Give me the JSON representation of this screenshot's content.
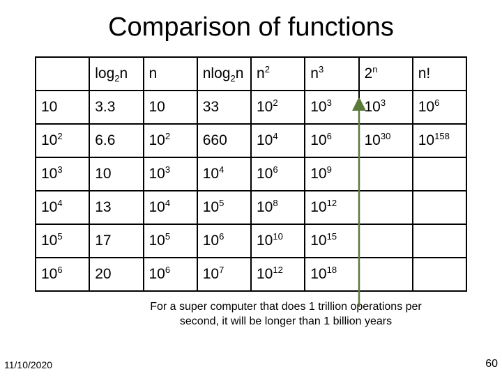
{
  "title": "Comparison of functions",
  "chart_data": {
    "type": "table",
    "columns": [
      {
        "text": "",
        "html": ""
      },
      {
        "text": "log2n",
        "html": "log<sub>2</sub>n"
      },
      {
        "text": "n",
        "html": "n"
      },
      {
        "text": "nlog2n",
        "html": "nlog<sub>2</sub>n"
      },
      {
        "text": "n^2",
        "html": "n<sup>2</sup>"
      },
      {
        "text": "n^3",
        "html": "n<sup>3</sup>"
      },
      {
        "text": "2^n",
        "html": "2<sup>n</sup>"
      },
      {
        "text": "n!",
        "html": "n!"
      }
    ],
    "rows": [
      [
        {
          "text": "10",
          "html": "10"
        },
        {
          "text": "3.3",
          "html": "3.3"
        },
        {
          "text": "10",
          "html": "10"
        },
        {
          "text": "33",
          "html": "33"
        },
        {
          "text": "10^2",
          "html": "10<sup>2</sup>"
        },
        {
          "text": "10^3",
          "html": "10<sup>3</sup>"
        },
        {
          "text": "10^3",
          "html": "10<sup>3</sup>"
        },
        {
          "text": "10^6",
          "html": "10<sup>6</sup>"
        }
      ],
      [
        {
          "text": "10^2",
          "html": "10<sup>2</sup>"
        },
        {
          "text": "6.6",
          "html": "6.6"
        },
        {
          "text": "10^2",
          "html": "10<sup>2</sup>"
        },
        {
          "text": "660",
          "html": "660"
        },
        {
          "text": "10^4",
          "html": "10<sup>4</sup>"
        },
        {
          "text": "10^6",
          "html": "10<sup>6</sup>"
        },
        {
          "text": "10^30",
          "html": "10<sup>30</sup>"
        },
        {
          "text": "10^158",
          "html": "10<sup>158</sup>"
        }
      ],
      [
        {
          "text": "10^3",
          "html": "10<sup>3</sup>"
        },
        {
          "text": "10",
          "html": "10"
        },
        {
          "text": "10^3",
          "html": "10<sup>3</sup>"
        },
        {
          "text": "10^4",
          "html": "10<sup>4</sup>"
        },
        {
          "text": "10^6",
          "html": "10<sup>6</sup>"
        },
        {
          "text": "10^9",
          "html": "10<sup>9</sup>"
        },
        {
          "text": "",
          "html": ""
        },
        {
          "text": "",
          "html": ""
        }
      ],
      [
        {
          "text": "10^4",
          "html": "10<sup>4</sup>"
        },
        {
          "text": "13",
          "html": "13"
        },
        {
          "text": "10^4",
          "html": "10<sup>4</sup>"
        },
        {
          "text": "10^5",
          "html": "10<sup>5</sup>"
        },
        {
          "text": "10^8",
          "html": "10<sup>8</sup>"
        },
        {
          "text": "10^12",
          "html": "10<sup>12</sup>"
        },
        {
          "text": "",
          "html": ""
        },
        {
          "text": "",
          "html": ""
        }
      ],
      [
        {
          "text": "10^5",
          "html": "10<sup>5</sup>"
        },
        {
          "text": "17",
          "html": "17"
        },
        {
          "text": "10^5",
          "html": "10<sup>5</sup>"
        },
        {
          "text": "10^6",
          "html": "10<sup>6</sup>"
        },
        {
          "text": "10^10",
          "html": "10<sup>10</sup>"
        },
        {
          "text": "10^15",
          "html": "10<sup>15</sup>"
        },
        {
          "text": "",
          "html": ""
        },
        {
          "text": "",
          "html": ""
        }
      ],
      [
        {
          "text": "10^6",
          "html": "10<sup>6</sup>"
        },
        {
          "text": "20",
          "html": "20"
        },
        {
          "text": "10^6",
          "html": "10<sup>6</sup>"
        },
        {
          "text": "10^7",
          "html": "10<sup>7</sup>"
        },
        {
          "text": "10^12",
          "html": "10<sup>12</sup>"
        },
        {
          "text": "10^18",
          "html": "10<sup>18</sup>"
        },
        {
          "text": "",
          "html": ""
        },
        {
          "text": "",
          "html": ""
        }
      ]
    ]
  },
  "caption": "For a super computer that does 1 trillion operations per second, it will be longer than 1 billion years",
  "footer": {
    "date": "11/10/2020",
    "pagenum": "60"
  },
  "arrow": {
    "color": "#5a7a3a"
  }
}
